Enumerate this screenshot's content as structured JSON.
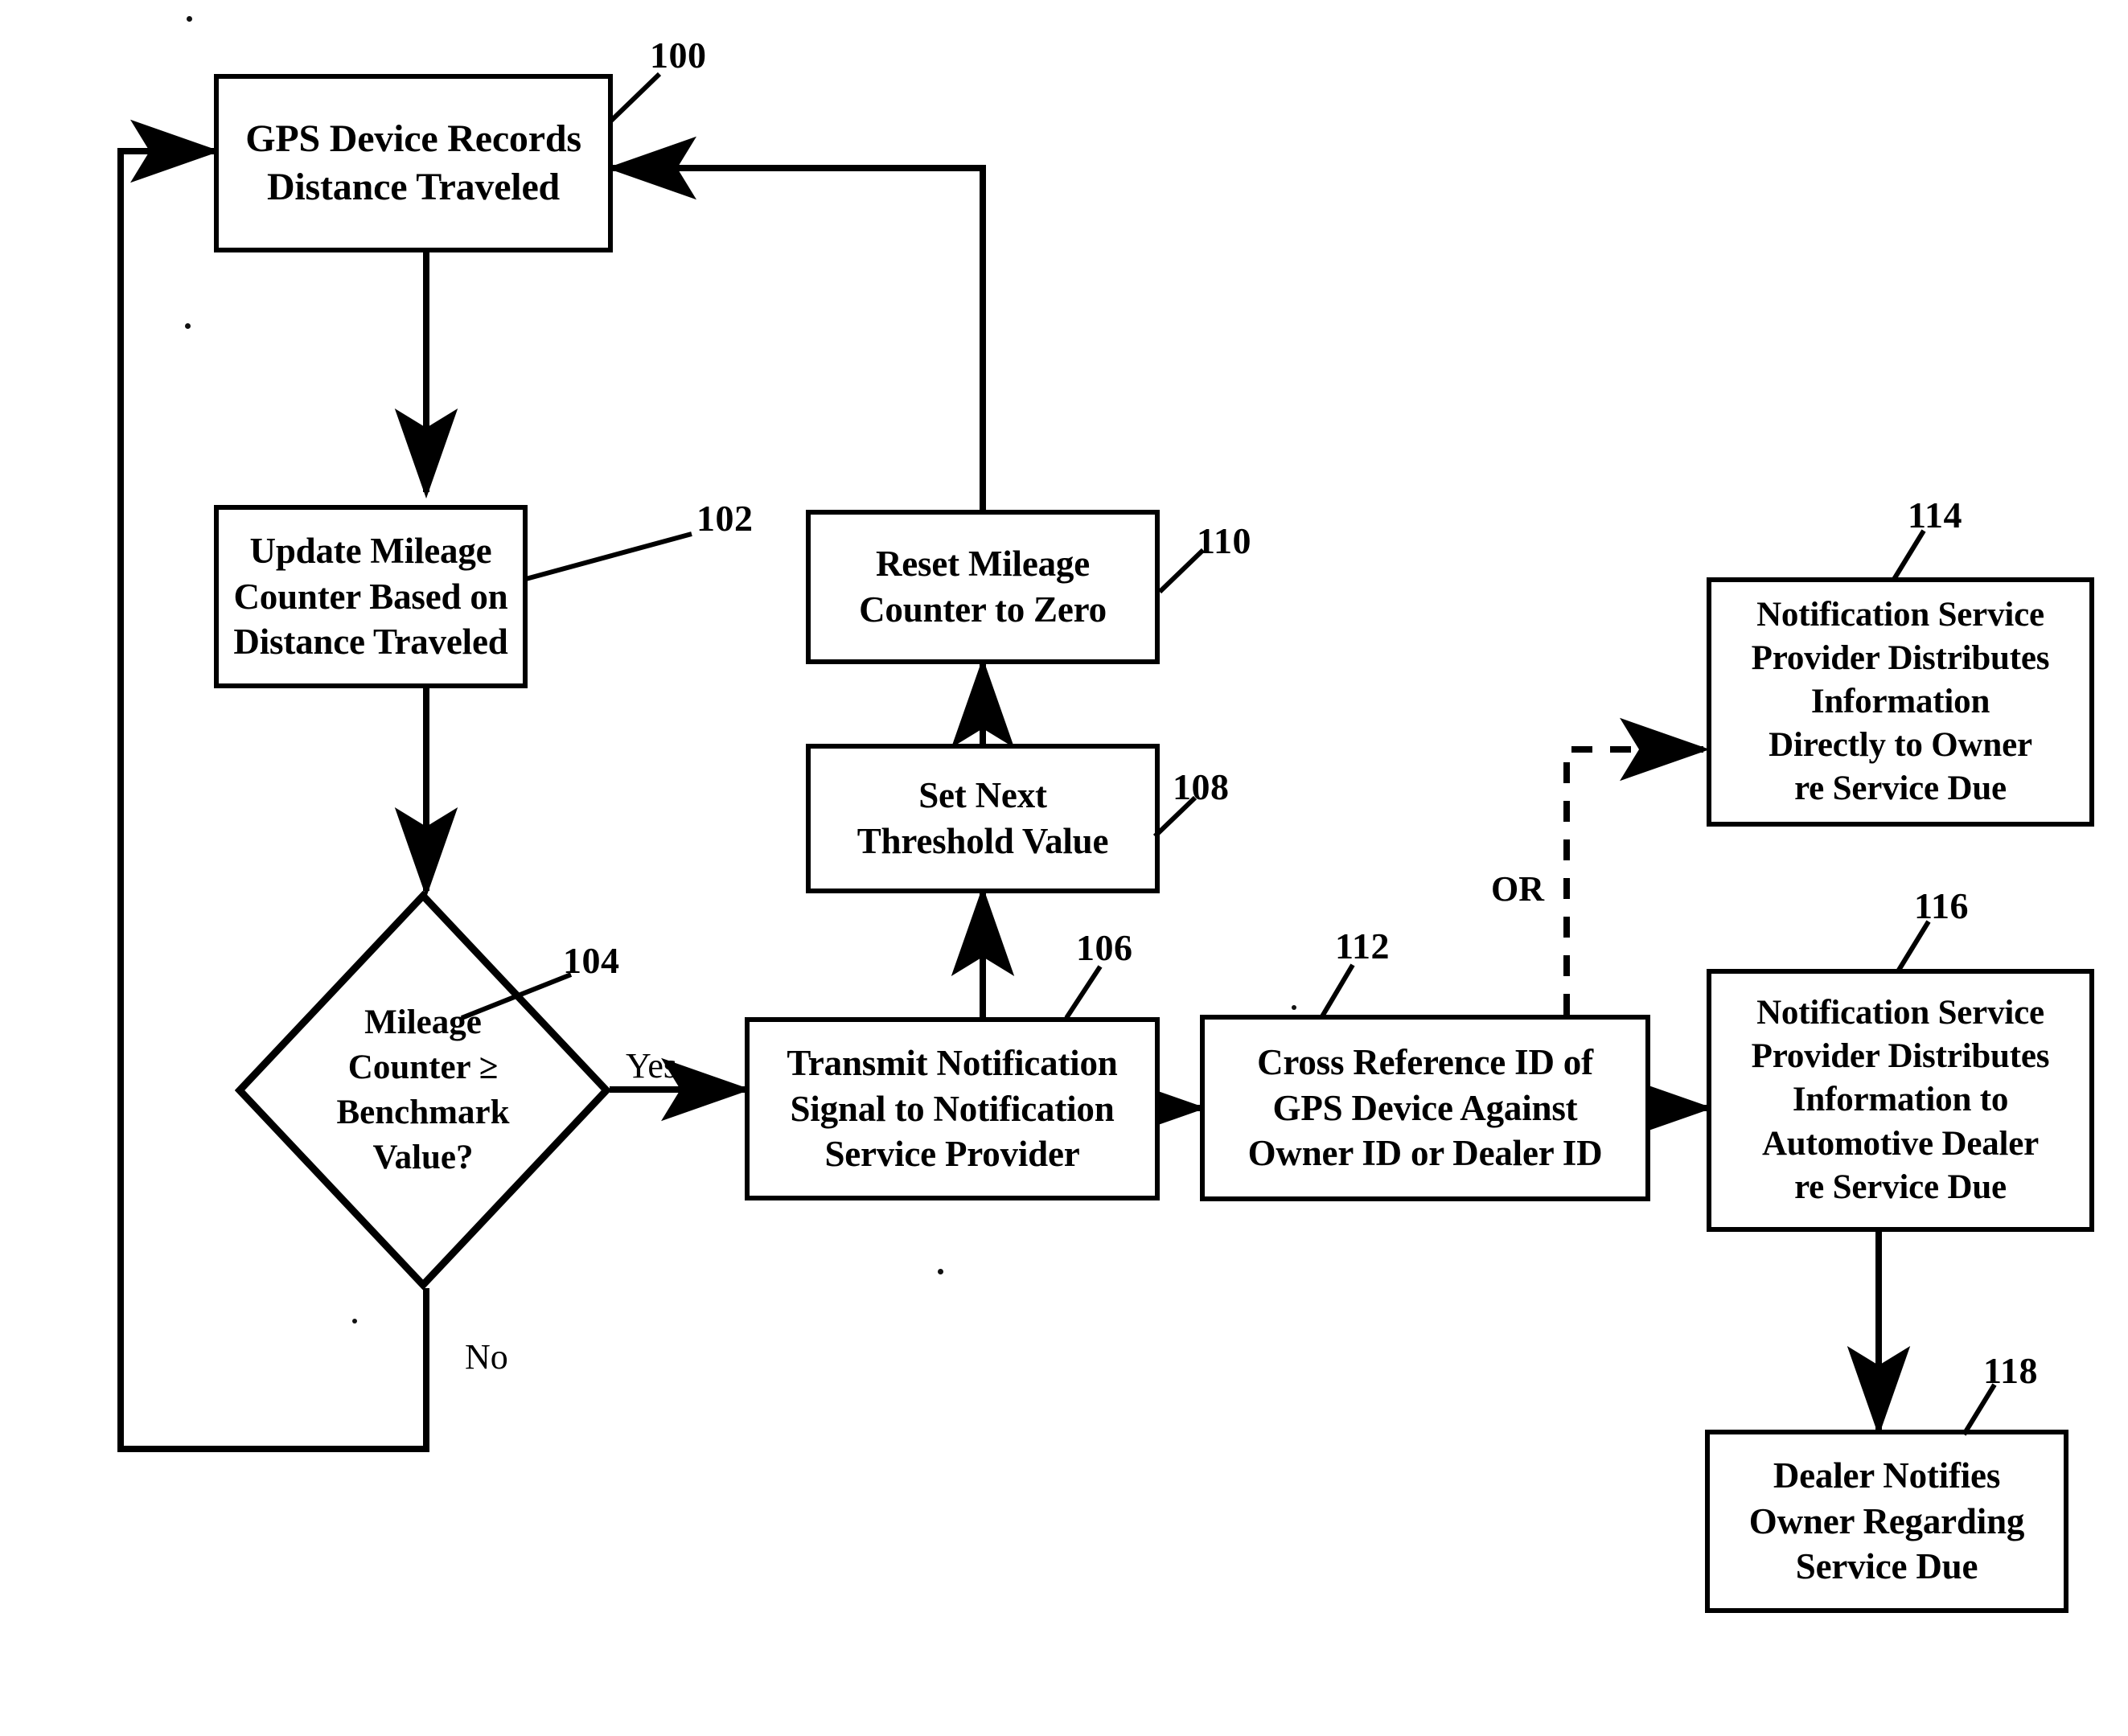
{
  "figure": {
    "type": "patent-flowchart",
    "background_color": "#ffffff",
    "line_color": "#000000"
  },
  "nodes": [
    {
      "id": "n100",
      "ref": "100",
      "shape": "process",
      "text": "GPS Device Records\nDistance Traveled"
    },
    {
      "id": "n102",
      "ref": "102",
      "shape": "process",
      "text": "Update Mileage\nCounter Based on\nDistance Traveled"
    },
    {
      "id": "n104",
      "ref": "104",
      "shape": "decision",
      "text": "Mileage\nCounter ≥\nBenchmark\nValue?"
    },
    {
      "id": "n106",
      "ref": "106",
      "shape": "process",
      "text": "Transmit Notification\nSignal to Notification\nService Provider"
    },
    {
      "id": "n108",
      "ref": "108",
      "shape": "process",
      "text": "Set Next\nThreshold Value"
    },
    {
      "id": "n110",
      "ref": "110",
      "shape": "process",
      "text": "Reset Mileage\nCounter to Zero"
    },
    {
      "id": "n112",
      "ref": "112",
      "shape": "process",
      "text": "Cross Reference ID of\nGPS Device Against\nOwner ID or Dealer ID"
    },
    {
      "id": "n114",
      "ref": "114",
      "shape": "process",
      "text": "Notification Service\nProvider Distributes\nInformation\nDirectly to Owner\nre Service Due"
    },
    {
      "id": "n116",
      "ref": "116",
      "shape": "process",
      "text": "Notification Service\nProvider Distributes\nInformation to\nAutomotive Dealer\nre Service Due"
    },
    {
      "id": "n118",
      "ref": "118",
      "shape": "process",
      "text": "Dealer Notifies\nOwner Regarding\nService Due"
    }
  ],
  "edge_labels": {
    "yes": "Yes",
    "no": "No",
    "or": "OR"
  }
}
